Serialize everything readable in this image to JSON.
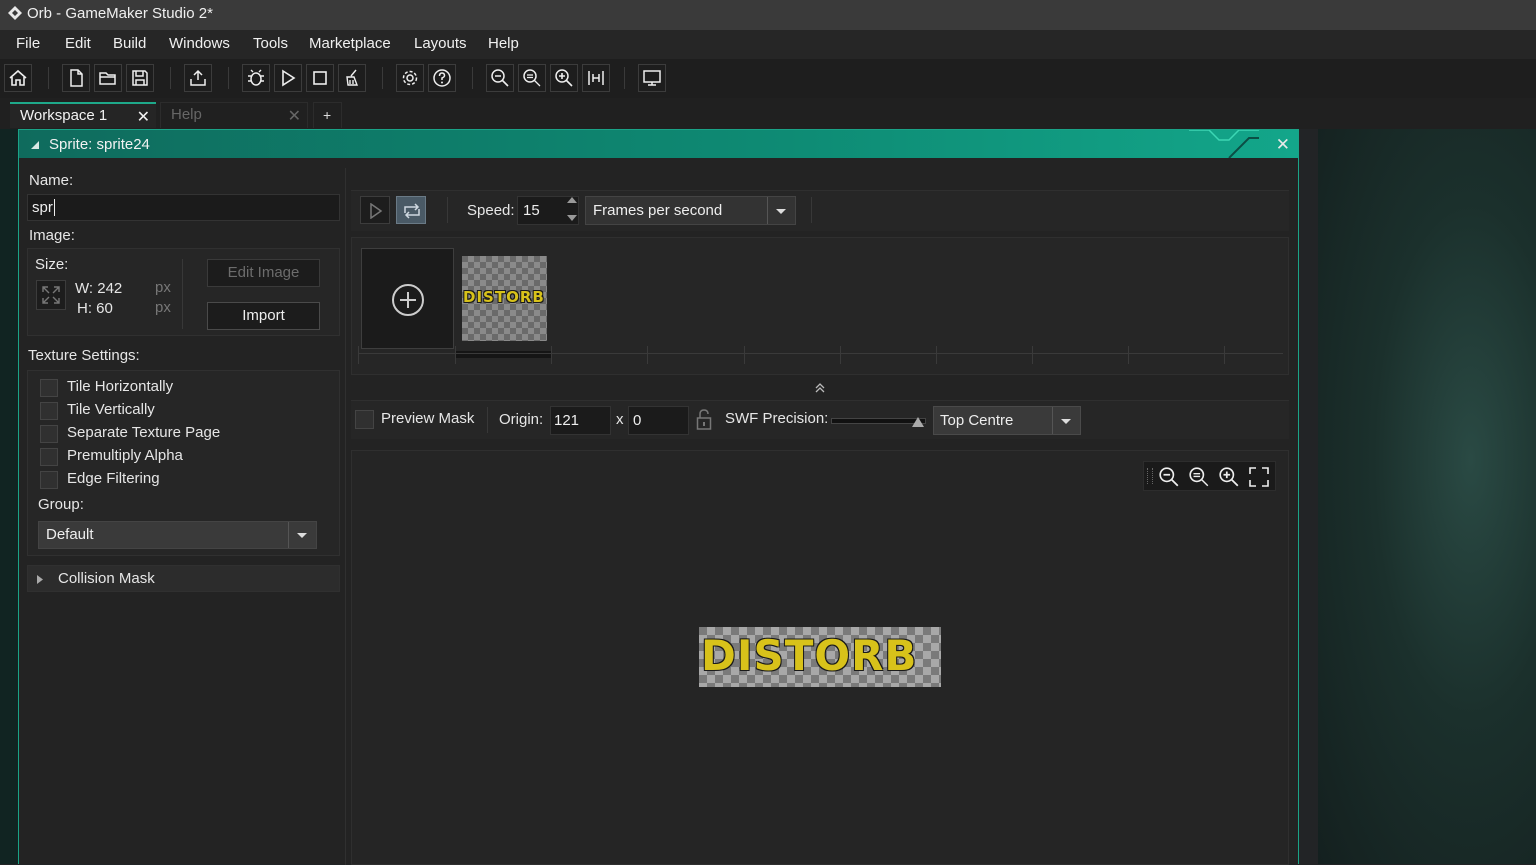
{
  "window": {
    "title": "Orb - GameMaker Studio 2*"
  },
  "menu": [
    "File",
    "Edit",
    "Build",
    "Windows",
    "Tools",
    "Marketplace",
    "Layouts",
    "Help"
  ],
  "toolbar_icons": [
    "home-icon",
    "new-file-icon",
    "open-folder-icon",
    "save-icon",
    "export-icon",
    "debug-icon",
    "play-icon",
    "stop-icon",
    "clean-icon",
    "settings-icon",
    "help-icon",
    "zoom-out-icon",
    "zoom-reset-icon",
    "zoom-in-icon",
    "fit-icon",
    "monitor-icon"
  ],
  "tabs": [
    {
      "label": "Workspace 1",
      "active": true
    },
    {
      "label": "Help",
      "active": false
    }
  ],
  "tab_add": "+",
  "sprite": {
    "window_title": "Sprite: sprite24",
    "name_label": "Name:",
    "name_value": "spr",
    "image_label": "Image:",
    "size_label": "Size:",
    "width": "W: 242",
    "height": "H: 60",
    "unit": "px",
    "edit_image": "Edit Image",
    "import": "Import",
    "texture_label": "Texture Settings:",
    "texture_options": [
      "Tile Horizontally",
      "Tile Vertically",
      "Separate Texture Page",
      "Premultiply Alpha",
      "Edge Filtering"
    ],
    "group_label": "Group:",
    "group_value": "Default",
    "collision_mask": "Collision Mask",
    "speed_label": "Speed:",
    "speed_value": "15",
    "speed_unit": "Frames per second",
    "preview_mask": "Preview Mask",
    "origin_label": "Origin:",
    "origin_x": "121",
    "origin_sep": "x",
    "origin_y": "0",
    "swf_label": "SWF Precision:",
    "origin_preset": "Top Centre",
    "frame_text": "DISTORB",
    "canvas_text": "DISTORB"
  },
  "colors": {
    "accent": "#1ea98a",
    "sprite_text": "#d8c21a"
  }
}
